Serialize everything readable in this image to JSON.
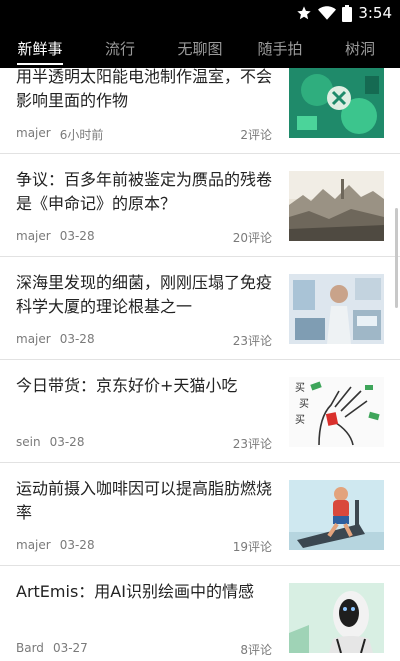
{
  "status_bar": {
    "time": "3:54"
  },
  "tabs": [
    {
      "label": "新鲜事",
      "active": true
    },
    {
      "label": "流行",
      "active": false
    },
    {
      "label": "无聊图",
      "active": false
    },
    {
      "label": "随手拍",
      "active": false
    },
    {
      "label": "树洞",
      "active": false
    }
  ],
  "articles": [
    {
      "title": "用半透明太阳能电池制作温室，不会影响里面的作物",
      "author": "majer",
      "time": "6小时前",
      "comments": "2评论",
      "thumb": "solar-greenhouse"
    },
    {
      "title": "争议：百多年前被鉴定为赝品的残卷是《申命记》的原本？",
      "author": "majer",
      "time": "03-28",
      "comments": "20评论",
      "thumb": "old-city-engraving"
    },
    {
      "title": "深海里发现的细菌，刚刚压塌了免疫科学大厦的理论根基之一",
      "author": "majer",
      "time": "03-28",
      "comments": "23评论",
      "thumb": "lab-equipment"
    },
    {
      "title": "今日带货：京东好价+天猫小吃",
      "author": "sein",
      "time": "03-28",
      "comments": "23评论",
      "thumb": "buy-buy-buy-cartoon"
    },
    {
      "title": "运动前摄入咖啡因可以提高脂肪燃烧率",
      "author": "majer",
      "time": "03-28",
      "comments": "19评论",
      "thumb": "treadmill-runner"
    },
    {
      "title": "ArtEmis：用AI识别绘画中的情感",
      "author": "Bard",
      "time": "03-27",
      "comments": "8评论",
      "thumb": "robot-face"
    }
  ],
  "cartoon_text": "买买买"
}
